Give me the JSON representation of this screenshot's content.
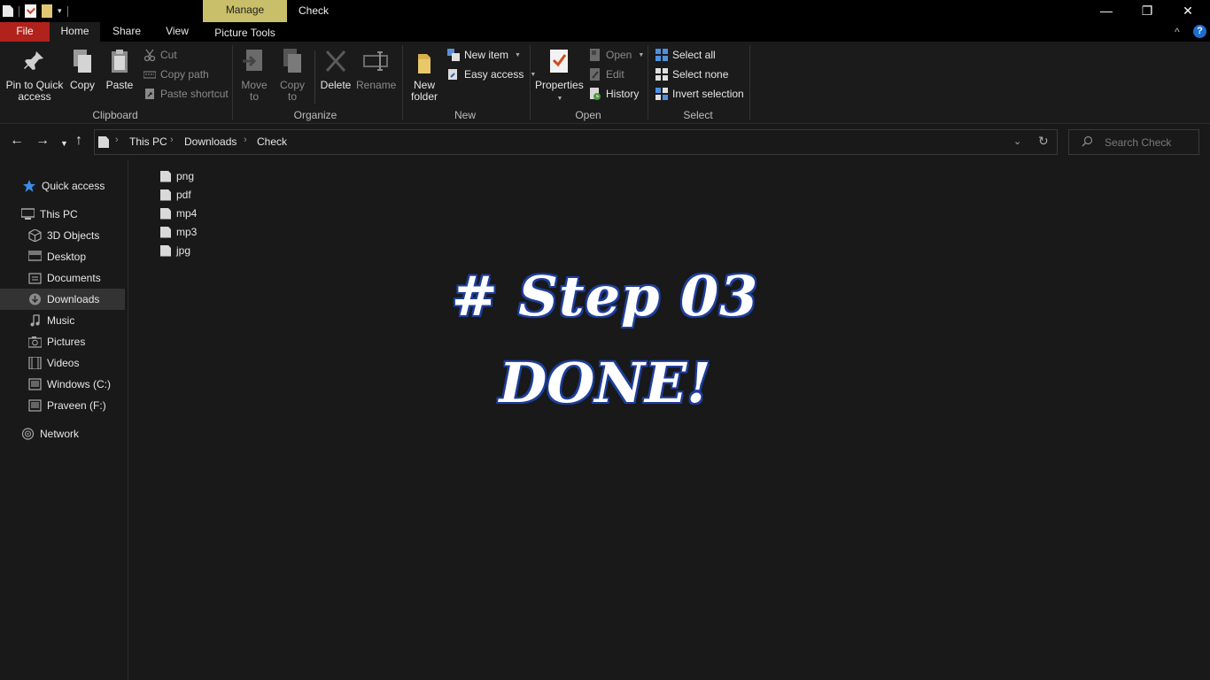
{
  "window": {
    "title": "Check",
    "context_tab": "Manage",
    "minimize": "—",
    "restore": "❐",
    "close": "✕"
  },
  "ribbon_tabs": {
    "file": "File",
    "home": "Home",
    "share": "Share",
    "view": "View",
    "picture_tools": "Picture Tools",
    "collapse": "^",
    "help": "?"
  },
  "clipboard": {
    "label": "Clipboard",
    "pin": "Pin to Quick access",
    "copy": "Copy",
    "paste": "Paste",
    "cut": "Cut",
    "copy_path": "Copy path",
    "paste_shortcut": "Paste shortcut"
  },
  "organize": {
    "label": "Organize",
    "move_to": "Move to",
    "copy_to": "Copy to",
    "delete": "Delete",
    "rename": "Rename"
  },
  "new_group": {
    "label": "New",
    "new_folder": "New folder",
    "new_item": "New item",
    "easy_access": "Easy access"
  },
  "open_group": {
    "label": "Open",
    "properties": "Properties",
    "open": "Open",
    "edit": "Edit",
    "history": "History"
  },
  "select_group": {
    "label": "Select",
    "select_all": "Select all",
    "select_none": "Select none",
    "invert_selection": "Invert selection"
  },
  "address": {
    "crumbs": [
      "This PC",
      "Downloads",
      "Check"
    ],
    "search_placeholder": "Search Check"
  },
  "sidebar": {
    "items": [
      {
        "label": "Quick access",
        "icon": "star-icon"
      },
      {
        "label": "This PC",
        "icon": "computer-icon"
      },
      {
        "label": "3D Objects",
        "icon": "cube-icon"
      },
      {
        "label": "Desktop",
        "icon": "desktop-icon"
      },
      {
        "label": "Documents",
        "icon": "documents-icon"
      },
      {
        "label": "Downloads",
        "icon": "download-icon"
      },
      {
        "label": "Music",
        "icon": "music-icon"
      },
      {
        "label": "Pictures",
        "icon": "camera-icon"
      },
      {
        "label": "Videos",
        "icon": "film-icon"
      },
      {
        "label": "Windows (C:)",
        "icon": "drive-icon"
      },
      {
        "label": "Praveen (F:)",
        "icon": "drive-icon"
      },
      {
        "label": "Network",
        "icon": "network-icon"
      }
    ],
    "selected": "Downloads"
  },
  "files": [
    "png",
    "pdf",
    "mp4",
    "mp3",
    "jpg"
  ],
  "overlay": {
    "line1": "# Step 03",
    "line2": "DONE!"
  },
  "colors": {
    "file_tab": "#b1221c",
    "manage_tab": "#c9bf6a",
    "background": "#191919",
    "overlay_outline": "#22429f"
  }
}
